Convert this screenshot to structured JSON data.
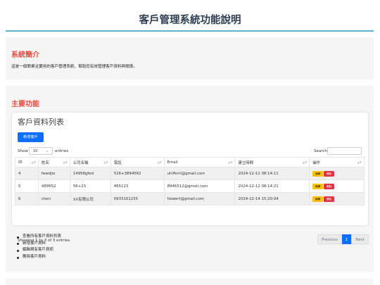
{
  "header": {
    "title": "客戶管理系統功能說明"
  },
  "intro": {
    "heading": "系統簡介",
    "text": "這是一個簡單且實用的客戶管理系統，幫助您有效管理客戶資料與關係。"
  },
  "features": {
    "heading": "主要功能",
    "card_title": "客戶資料列表",
    "add_button": "新增客戶",
    "show_label": "Show",
    "page_length": "10",
    "entries_label": "entries",
    "search_label": "Search:",
    "search_value": "",
    "columns": [
      "ID",
      "姓名",
      "公司名稱",
      "電話",
      "Email",
      "建立時間",
      "操作"
    ],
    "rows": [
      [
        "4",
        "fewdjio",
        "14958gfed",
        "526+3894562",
        "uhifkml@gmail.com",
        "2024-12-12 08:14:11"
      ],
      [
        "5",
        "489652",
        "56+23",
        "465123",
        "8946512@gmail.com",
        "2024-12-12 08:14:21"
      ],
      [
        "6",
        "chen",
        "XX有限公司",
        "0933101235",
        "tiowert@gmail.com",
        "2024-12-14 15:20:04"
      ]
    ],
    "edit_label": "編輯",
    "delete_label": "刪除",
    "info": "Showing 1 to 3 of 3 entries",
    "pager": {
      "previous": "Previous",
      "current": "1",
      "next": "Next"
    },
    "list": [
      "查看所有客戶資料列表",
      "新增客戶資料",
      "編輯現有客戶資訊",
      "刪除客戶資料"
    ]
  },
  "colors": {
    "title": "#2c3e50",
    "heading_accent": "#e74c3c",
    "primary": "#0d6efd",
    "warning": "#ffc107",
    "danger": "#dc3545",
    "rule": "#5fb4c9"
  }
}
